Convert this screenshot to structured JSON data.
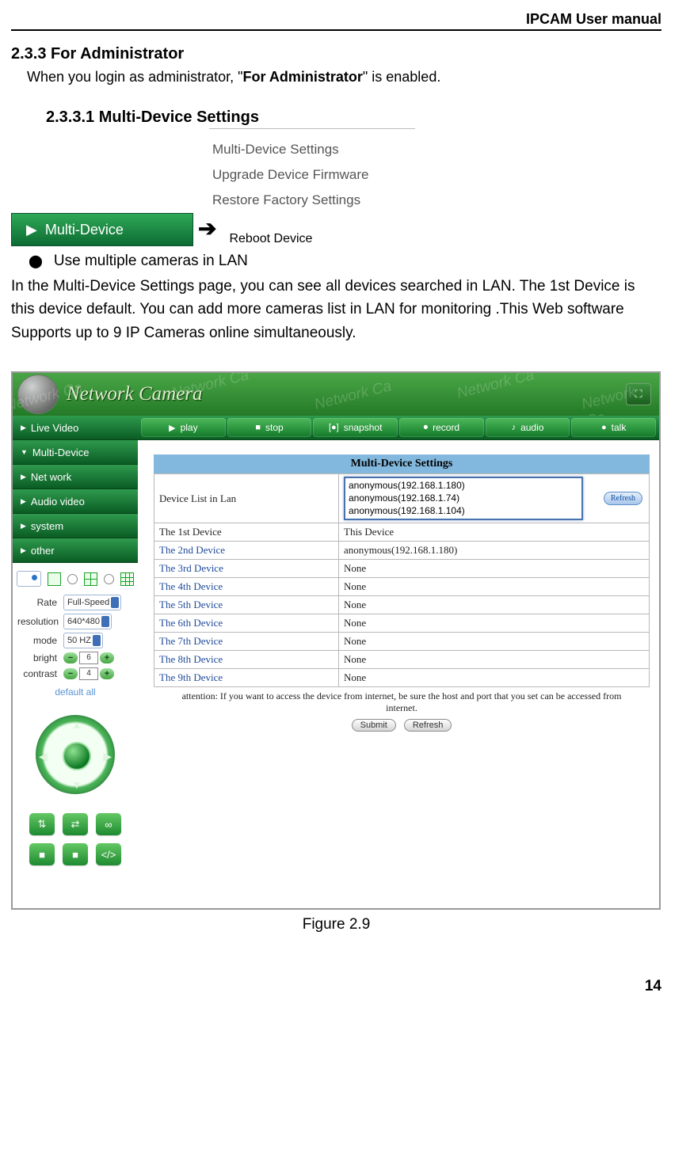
{
  "header": {
    "doc_title": "IPCAM User manual"
  },
  "section": {
    "num_title": "2.3.3    For Administrator",
    "intro_pre": "When you login as administrator, \"",
    "intro_bold": "For Administrator",
    "intro_post": "\" is enabled.",
    "sub_title": "2.3.3.1 Multi-Device Settings"
  },
  "panel1": {
    "items": [
      "Multi-Device Settings",
      "Upgrade Device Firmware",
      "Restore Factory Settings",
      "Reboot Device"
    ],
    "button_label": "Multi-Device",
    "arrow": "➔"
  },
  "bullet": {
    "text": "Use multiple cameras in LAN"
  },
  "para": "In the Multi-Device Settings page, you can see all devices searched in LAN. The 1st Device is this device default. You can add more cameras list in LAN for monitoring .This Web software Supports up to 9 IP Cameras online simultaneously.",
  "shot": {
    "watermark": "Network Ca",
    "title": "Network Camera",
    "sidebar_items": [
      {
        "arrow": "▶",
        "label": "Live Video"
      },
      {
        "arrow": "▼",
        "label": "Multi-Device"
      },
      {
        "arrow": "▶",
        "label": "Net work"
      },
      {
        "arrow": "▶",
        "label": "Audio video"
      },
      {
        "arrow": "▶",
        "label": "system"
      },
      {
        "arrow": "▶",
        "label": "other"
      }
    ],
    "controls": {
      "rate_label": "Rate",
      "rate_value": "Full-Speed",
      "res_label": "resolution",
      "res_value": "640*480",
      "mode_label": "mode",
      "mode_value": "50 HZ",
      "bright_label": "bright",
      "bright_value": "6",
      "contrast_label": "contrast",
      "contrast_value": "4",
      "default_all": "default all"
    },
    "toolbar": [
      {
        "icon": "▶",
        "label": "play"
      },
      {
        "icon": "■",
        "label": "stop"
      },
      {
        "icon": "[●]",
        "label": "snapshot"
      },
      {
        "icon": "⏺",
        "label": "record"
      },
      {
        "icon": "♪",
        "label": "audio"
      },
      {
        "icon": "●",
        "label": "talk"
      }
    ],
    "mds_title": "Multi-Device Settings",
    "device_list_label": "Device List in Lan",
    "device_list": [
      "anonymous(192.168.1.180)",
      "anonymous(192.168.1.74)",
      "anonymous(192.168.1.104)"
    ],
    "refresh": "Refresh",
    "rows": [
      {
        "k": "The 1st Device",
        "v": "This Device",
        "first": true
      },
      {
        "k": "The 2nd Device",
        "v": "anonymous(192.168.1.180)"
      },
      {
        "k": "The 3rd Device",
        "v": "None"
      },
      {
        "k": "The 4th Device",
        "v": "None"
      },
      {
        "k": "The 5th Device",
        "v": "None"
      },
      {
        "k": "The 6th Device",
        "v": "None"
      },
      {
        "k": "The 7th Device",
        "v": "None"
      },
      {
        "k": "The 8th Device",
        "v": "None"
      },
      {
        "k": "The 9th Device",
        "v": "None"
      }
    ],
    "attention": "attention: If you want to access the device from internet, be sure the host and port that you set can be accessed from internet.",
    "submit": "Submit",
    "refresh2": "Refresh"
  },
  "figure_caption": "Figure 2.9",
  "page_number": "14"
}
